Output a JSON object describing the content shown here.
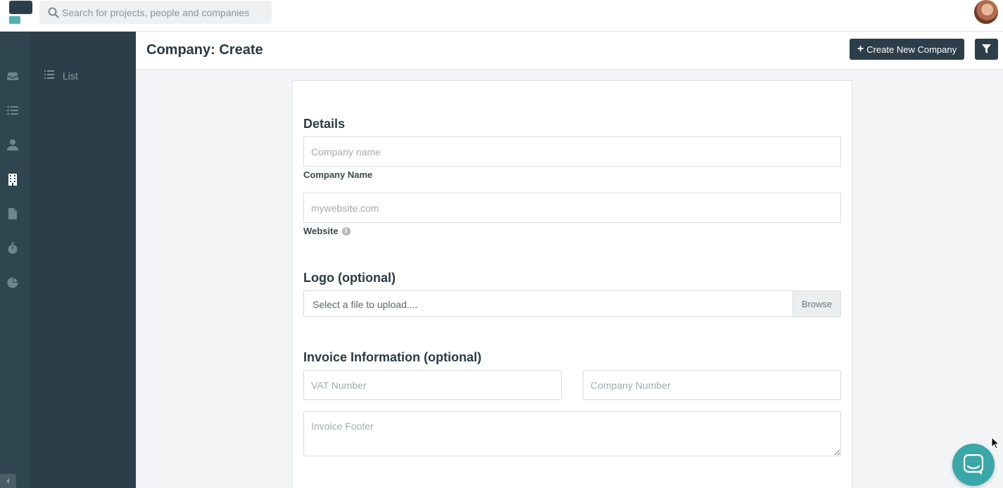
{
  "topbar": {
    "search_placeholder": "Search for projects, people and companies"
  },
  "rail": {
    "icons": [
      "inbox-icon",
      "list-icon",
      "user-icon",
      "building-icon",
      "document-icon",
      "stopwatch-icon",
      "pie-chart-icon"
    ],
    "active": "building-icon"
  },
  "subnav": {
    "items": [
      {
        "label": "List",
        "icon": "list-icon"
      }
    ]
  },
  "header": {
    "title": "Company: Create",
    "create_button": "Create New Company",
    "filter_icon": "filter-icon"
  },
  "form": {
    "details": {
      "title": "Details",
      "company_name_placeholder": "Company name",
      "company_name_label": "Company Name",
      "website_placeholder": "mywebsite.com",
      "website_label": "Website"
    },
    "logo": {
      "title": "Logo (optional)",
      "file_text": "Select a file to upload....",
      "browse_label": "Browse"
    },
    "invoice": {
      "title": "Invoice Information (optional)",
      "vat_placeholder": "VAT Number",
      "company_number_placeholder": "Company Number",
      "footer_placeholder": "Invoice Footer"
    }
  },
  "colors": {
    "dark": "#2c3e4a",
    "rail": "#2f4550",
    "accent": "#3aa7a8",
    "teal_logo": "#4fb3b0"
  }
}
